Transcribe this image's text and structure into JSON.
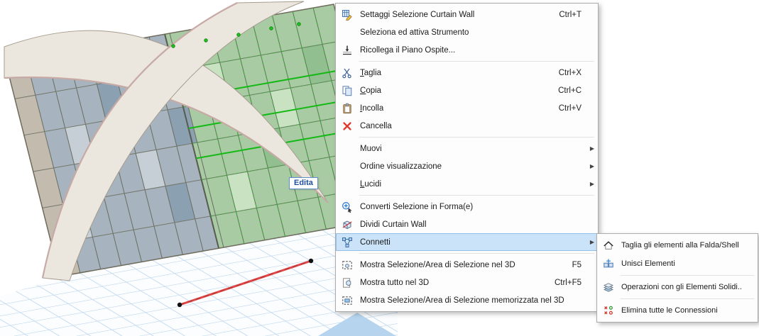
{
  "viewport": {
    "edit_tooltip": "Edita"
  },
  "colors": {
    "menu_highlight": "#cbe3f8",
    "menu_highlight_border": "#92bfe8",
    "selection_green": "#15b915",
    "selection_red": "#e04848",
    "tooltip_blue": "#1d4f9e"
  },
  "context_menu": {
    "items": [
      {
        "icon": "curtain-wall-settings",
        "label": "Settaggi Selezione Curtain Wall",
        "shortcut": "Ctrl+T"
      },
      {
        "icon": "",
        "label": "Seleziona ed attiva Strumento",
        "shortcut": ""
      },
      {
        "icon": "story-reconnect",
        "label": "Ricollega il Piano Ospite...",
        "shortcut": "",
        "separator_after": true
      },
      {
        "icon": "cut",
        "label": "Taglia",
        "shortcut": "Ctrl+X",
        "accel": "T"
      },
      {
        "icon": "copy",
        "label": "Copia",
        "shortcut": "Ctrl+C",
        "accel": "C"
      },
      {
        "icon": "paste",
        "label": "Incolla",
        "shortcut": "Ctrl+V",
        "accel": "I"
      },
      {
        "icon": "delete",
        "label": "Cancella",
        "shortcut": "",
        "separator_after": true
      },
      {
        "icon": "",
        "label": "Muovi",
        "shortcut": "",
        "submenu": true
      },
      {
        "icon": "",
        "label": "Ordine visualizzazione",
        "shortcut": "",
        "submenu": true
      },
      {
        "icon": "",
        "label": "Lucidi",
        "shortcut": "",
        "submenu": true,
        "accel": "L",
        "separator_after": true
      },
      {
        "icon": "convert-morph",
        "label": "Converti Selezione in Forma(e)",
        "shortcut": ""
      },
      {
        "icon": "divide-curtain-wall",
        "label": "Dividi Curtain Wall",
        "shortcut": ""
      },
      {
        "icon": "connect",
        "label": "Connetti",
        "shortcut": "",
        "submenu": true,
        "highlighted": true,
        "separator_after": true
      },
      {
        "icon": "show-selection-3d",
        "label": "Mostra Selezione/Area di Selezione nel 3D",
        "shortcut": "F5"
      },
      {
        "icon": "show-all-3d",
        "label": "Mostra tutto nel 3D",
        "shortcut": "Ctrl+F5"
      },
      {
        "icon": "show-stored-selection-3d",
        "label": "Mostra Selezione/Area di Selezione memorizzata nel 3D",
        "shortcut": ""
      }
    ]
  },
  "connect_submenu": {
    "items": [
      {
        "icon": "trim-to-roof",
        "label": "Taglia gli elementi alla Falda/Shell",
        "shortcut": ""
      },
      {
        "icon": "merge-elements",
        "label": "Unisci Elementi",
        "shortcut": "",
        "separator_after": true
      },
      {
        "icon": "solid-operations",
        "label": "Operazioni con gli Elementi Solidi...",
        "shortcut": "",
        "separator_after": true
      },
      {
        "icon": "delete-connections",
        "label": "Elimina tutte le Connessioni",
        "shortcut": ""
      }
    ]
  }
}
